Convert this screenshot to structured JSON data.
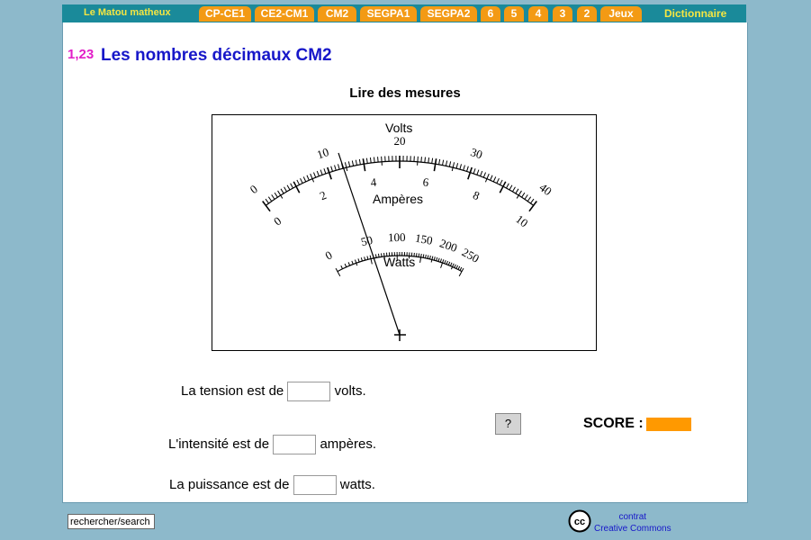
{
  "nav": {
    "brand": "Le Matou matheux",
    "tabs": [
      "CP-CE1",
      "CE2-CM1",
      "CM2",
      "SEGPA1",
      "SEGPA2",
      "6",
      "5",
      "4",
      "3",
      "2",
      "Jeux"
    ],
    "dictionary": "Dictionnaire"
  },
  "header": {
    "logo_number": "1,23",
    "title": "Les nombres décimaux CM2"
  },
  "exercise": {
    "subtitle": "Lire des mesures",
    "meter": {
      "volts_label": "Volts",
      "amperes_label": "Ampères",
      "watts_label": "Watts",
      "volt_ticks": [
        "0",
        "10",
        "20",
        "30",
        "40"
      ],
      "amp_ticks": [
        "0",
        "2",
        "4",
        "6",
        "8",
        "10"
      ],
      "watt_ticks": [
        "0",
        "50",
        "100",
        "150",
        "200",
        "250"
      ]
    },
    "q1": {
      "before": "La tension est de",
      "after": "volts."
    },
    "q2": {
      "before": "L'intensité est de",
      "after": "ampères."
    },
    "q3": {
      "before": "La puissance est de",
      "after": "watts."
    },
    "help_label": "?",
    "score_label": "SCORE :"
  },
  "footer": {
    "search_placeholder": "rechercher/search",
    "cc_line1": "contrat",
    "cc_line2": "Creative Commons",
    "cc_logo": "cc"
  }
}
